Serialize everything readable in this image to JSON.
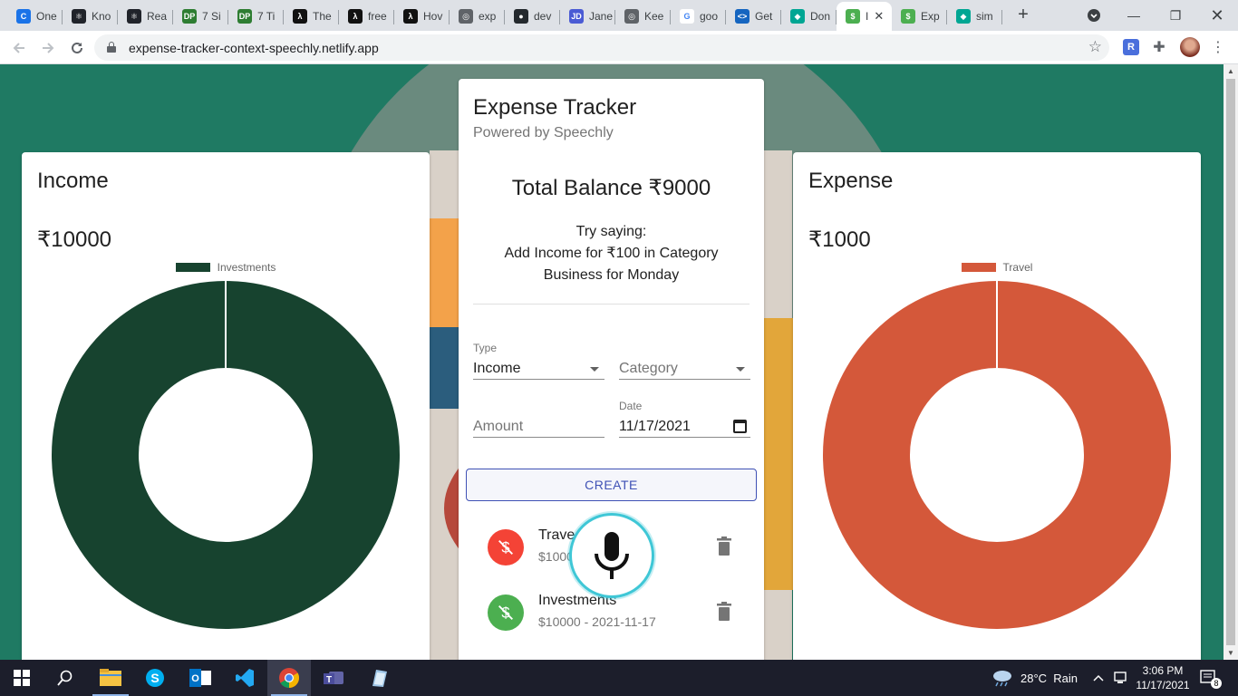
{
  "browser": {
    "tabs": [
      {
        "label": "One",
        "icon": "c-logo-icon",
        "color": "#1a73e8",
        "glyph": "C"
      },
      {
        "label": "Kno",
        "icon": "react-icon",
        "color": "#20232a",
        "glyph": "⚛"
      },
      {
        "label": "Rea",
        "icon": "react-icon",
        "color": "#20232a",
        "glyph": "⚛"
      },
      {
        "label": "7 Si",
        "icon": "dp-icon",
        "color": "#2e7d32",
        "glyph": "DP"
      },
      {
        "label": "7 Ti",
        "icon": "dp-icon",
        "color": "#2e7d32",
        "glyph": "DP"
      },
      {
        "label": "The",
        "icon": "lambda-icon",
        "color": "#111111",
        "glyph": "λ"
      },
      {
        "label": "free",
        "icon": "lambda-icon",
        "color": "#111111",
        "glyph": "λ"
      },
      {
        "label": "Hov",
        "icon": "lambda-icon",
        "color": "#111111",
        "glyph": "λ"
      },
      {
        "label": "exp",
        "icon": "globe-icon",
        "color": "#5f6368",
        "glyph": "◎"
      },
      {
        "label": "dev",
        "icon": "github-icon",
        "color": "#24292e",
        "glyph": "●"
      },
      {
        "label": "Jane",
        "icon": "jd-icon",
        "color": "#4a5bd4",
        "glyph": "JD"
      },
      {
        "label": "Kee",
        "icon": "globe-icon",
        "color": "#5f6368",
        "glyph": "◎"
      },
      {
        "label": "goo",
        "icon": "google-icon",
        "color": "#ffffff",
        "glyph": "G"
      },
      {
        "label": "Get",
        "icon": "code-icon",
        "color": "#1565c0",
        "glyph": "<>"
      },
      {
        "label": "Don",
        "icon": "diamond-icon",
        "color": "#00a693",
        "glyph": "◆"
      },
      {
        "label": "I",
        "icon": "expense-icon",
        "color": "#4caf50",
        "glyph": "$"
      },
      {
        "label": "Exp",
        "icon": "expense-icon",
        "color": "#4caf50",
        "glyph": "$"
      },
      {
        "label": "sim",
        "icon": "diamond-icon",
        "color": "#00a693",
        "glyph": "◆"
      }
    ],
    "url": "expense-tracker-context-speechly.netlify.app"
  },
  "income": {
    "title": "Income",
    "amount": "₹10000",
    "legend": "Investments",
    "color": "#17432f",
    "strip_color": "#69f075"
  },
  "expense": {
    "title": "Expense",
    "amount": "₹1000",
    "legend": "Travel",
    "color": "#d4583a",
    "strip_color": "#ef7d74"
  },
  "tracker": {
    "title": "Expense Tracker",
    "subtitle": "Powered by Speechly",
    "balance": "Total Balance ₹9000",
    "hint_line1": "Try saying:",
    "hint_line2": "Add Income for ₹100 in Category",
    "hint_line3": "Business for Monday",
    "form": {
      "type_label": "Type",
      "type_value": "Income",
      "category_placeholder": "Category",
      "amount_placeholder": "Amount",
      "date_label": "Date",
      "date_value": "11/17/2021",
      "create_label": "CREATE"
    },
    "transactions": [
      {
        "name": "Trave",
        "detail": "$1000",
        "kind": "expense",
        "color": "#f44336"
      },
      {
        "name": "Investments",
        "detail": "$10000 - 2021-11-17",
        "kind": "income",
        "color": "#4caf50"
      }
    ]
  },
  "taskbar": {
    "weather": "28°C  Rain",
    "time": "3:06 PM",
    "date": "11/17/2021",
    "notifications": "8"
  }
}
